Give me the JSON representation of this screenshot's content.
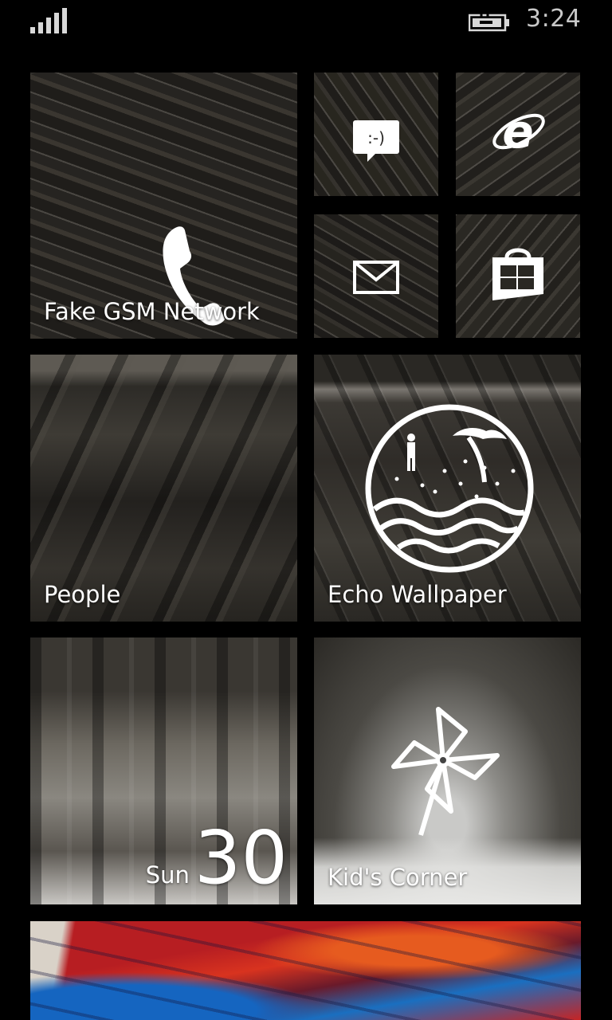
{
  "status_bar": {
    "time": "3:24",
    "signal_icon": "signal-bars-icon",
    "battery_icon": "battery-charging-icon"
  },
  "tiles": {
    "phone": {
      "label": "Fake GSM Network",
      "icon": "phone-icon"
    },
    "messaging": {
      "icon": "message-icon",
      "glyph": ":-)"
    },
    "internet_explorer": {
      "icon": "internet-explorer-icon",
      "glyph": "e"
    },
    "mail": {
      "icon": "mail-icon"
    },
    "store": {
      "icon": "store-icon"
    },
    "people": {
      "label": "People"
    },
    "echo_wallpaper": {
      "label": "Echo Wallpaper",
      "icon": "beach-wallpaper-icon"
    },
    "calendar": {
      "day": "Sun",
      "date": "30"
    },
    "kids_corner": {
      "label": "Kid's Corner",
      "icon": "pinwheel-icon"
    },
    "photos": {
      "icon": "painting-photo"
    }
  },
  "colors": {
    "background": "#000000",
    "tile_text": "#ffffff",
    "clock": "#c8c8c8"
  }
}
